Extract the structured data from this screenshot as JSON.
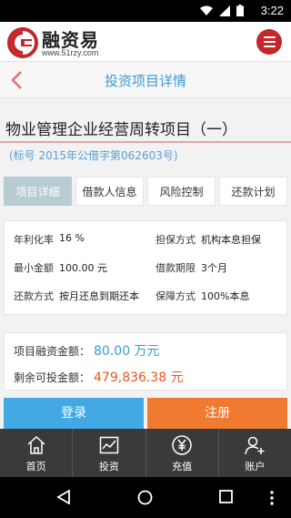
{
  "status_bar": {
    "time": "3:22"
  },
  "brand": {
    "name": "融资易",
    "url": "www.51rzy.com"
  },
  "header": {
    "title": "投资项目详情"
  },
  "project": {
    "title": "物业管理企业经营周转项目（一）",
    "subtitle": "(标号 2015年公借字第062603号)"
  },
  "tabs": [
    {
      "label": "项目详细",
      "active": true
    },
    {
      "label": "借款人信息",
      "active": false
    },
    {
      "label": "风险控制",
      "active": false
    },
    {
      "label": "还款计划",
      "active": false
    }
  ],
  "details": {
    "annual_rate_label": "年利化率",
    "annual_rate_value": "16 %",
    "guarantee_label": "担保方式",
    "guarantee_value": "机构本息担保",
    "min_amount_label": "最小金额",
    "min_amount_value": "100.00 元",
    "term_label": "借款期限",
    "term_value": "3个月",
    "repay_label": "还款方式",
    "repay_value": "按月还息到期还本",
    "protection_label": "保障方式",
    "protection_value": "100%本息"
  },
  "amounts": {
    "total_label": "项目融资金额：",
    "total_value": "80.00 万元",
    "remaining_label": "剩余可投金额：",
    "remaining_value": "479,836.38 元"
  },
  "actions": {
    "login": "登录",
    "register": "注册"
  },
  "bottom_nav": {
    "home": "首页",
    "invest": "投资",
    "recharge": "充值",
    "account": "账户"
  },
  "colors": {
    "accent_blue": "#3b9ad8",
    "brand_red": "#c3272b",
    "orange": "#f07b30",
    "amount_orange": "#e9571f"
  }
}
